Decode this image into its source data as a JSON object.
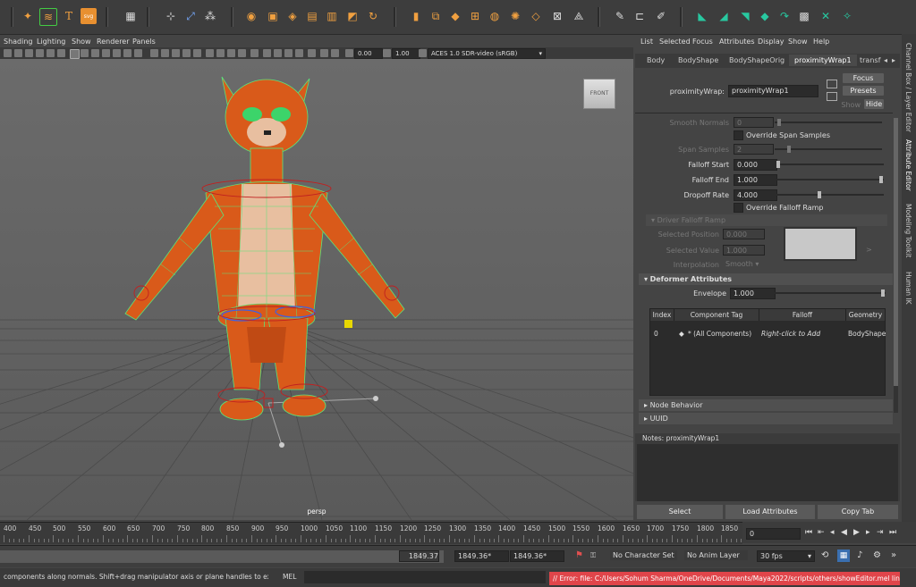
{
  "viewport": {
    "menu": [
      "Shading",
      "Lighting",
      "Show",
      "Renderer",
      "Panels"
    ],
    "exposure": "0.00",
    "gamma": "1.00",
    "colorspace": "ACES 1.0 SDR-video (sRGB)",
    "cube_label": "FRONT",
    "camera": "persp"
  },
  "editor_menu": [
    "List",
    "Selected",
    "Focus",
    "Attributes",
    "Display",
    "Show",
    "Help"
  ],
  "tabs": [
    {
      "label": "Body",
      "active": false
    },
    {
      "label": "BodyShape",
      "active": false
    },
    {
      "label": "BodyShapeOrig",
      "active": false
    },
    {
      "label": "proximityWrap1",
      "active": true
    },
    {
      "label": "transf",
      "active": false
    }
  ],
  "node": {
    "type_label": "proximityWrap:",
    "name": "proximityWrap1",
    "focus_btn": "Focus",
    "presets_btn": "Presets",
    "show_label": "Show",
    "hide_btn": "Hide"
  },
  "attrs": {
    "smooth_normals": {
      "label": "Smooth Normals",
      "value": "0"
    },
    "override_span": "Override Span Samples",
    "span_samples": {
      "label": "Span Samples",
      "value": "2"
    },
    "falloff_start": {
      "label": "Falloff Start",
      "value": "0.000",
      "level": 0.0
    },
    "falloff_end": {
      "label": "Falloff End",
      "value": "1.000",
      "level": 1.0
    },
    "dropoff_rate": {
      "label": "Dropoff Rate",
      "value": "4.000",
      "level": 0.4
    },
    "override_ramp": "Override Falloff Ramp",
    "driver_ramp_section": "Driver Falloff Ramp",
    "selected_position": {
      "label": "Selected Position",
      "value": "0.000"
    },
    "selected_value": {
      "label": "Selected Value",
      "value": "1.000"
    },
    "interpolation": {
      "label": "Interpolation",
      "value": "Smooth"
    },
    "ramp_arrow": ">",
    "deformer_section": "Deformer Attributes",
    "envelope": {
      "label": "Envelope",
      "value": "1.000",
      "level": 1.0
    }
  },
  "table": {
    "headers": [
      "Index",
      "Component Tag",
      "Falloff",
      "Geometry"
    ],
    "rows": [
      {
        "index": "0",
        "tag": "* (All Components)",
        "falloff": "Right-click to Add",
        "geometry": "BodyShape"
      }
    ]
  },
  "sections": [
    "Node Behavior",
    "UUID"
  ],
  "notes_label": "Notes:  proximityWrap1",
  "bottom_buttons": [
    "Select",
    "Load Attributes",
    "Copy Tab"
  ],
  "side_tabs": [
    "Channel Box / Layer Editor",
    "Attribute Editor",
    "Modeling Toolkit",
    "Human IK"
  ],
  "timeline": {
    "ticks": [
      "400",
      "450",
      "500",
      "550",
      "600",
      "650",
      "700",
      "750",
      "800",
      "850",
      "900",
      "950",
      "1000",
      "1050",
      "1100",
      "1150",
      "1200",
      "1250",
      "1300",
      "1350",
      "1400",
      "1450",
      "1500",
      "1550",
      "1600",
      "1650",
      "1700",
      "1750",
      "1800",
      "1850"
    ],
    "current": "0"
  },
  "range": {
    "a": "1849.37",
    "b": "1849.36*",
    "c": "1849.36*",
    "char_set": "No Character Set",
    "anim_layer": "No Anim Layer",
    "fps": "30 fps"
  },
  "status": {
    "help": "components along normals. Shift+drag manipulator axis or plane handles to extrude components or c",
    "mel": "MEL",
    "error": "// Error: file: C:/Users/Sohum Sharma/OneDrive/Documents/Maya2022/scripts/others/showEditor.mel line 3703: line"
  },
  "colors": {
    "accent_green": "#28c8a0",
    "error_red": "#e0454a",
    "fur_orange": "#d95a1a",
    "belly": "#e8bfa0"
  }
}
